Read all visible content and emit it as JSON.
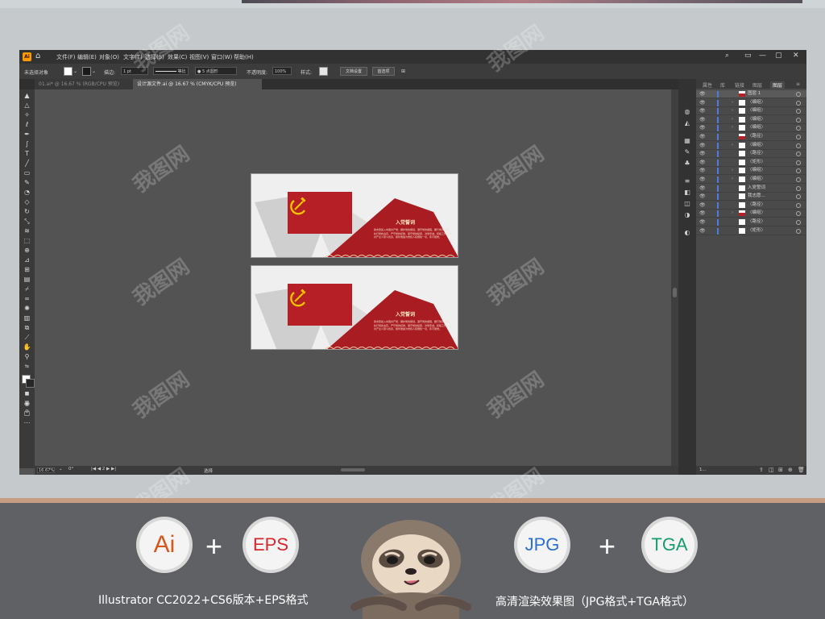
{
  "app": {
    "logo_text": "Ai",
    "menu": [
      "文件(F)",
      "编辑(E)",
      "对象(O)",
      "文字(T)",
      "选择(S)",
      "效果(C)",
      "视图(V)",
      "窗口(W)",
      "帮助(H)"
    ],
    "window_controls": [
      "—",
      "▢",
      "✕"
    ]
  },
  "controlbar": {
    "selection_label": "未选择对象",
    "stroke_label": "描边:",
    "stroke_value": "1 pt",
    "stroke_style": "等比",
    "brush": "5 点圆形",
    "opacity_label": "不透明度:",
    "opacity_value": "100%",
    "style_label": "样式:",
    "doc_setup_button": "文档设置",
    "preferences_button": "首选项"
  },
  "tabs": [
    {
      "label": "01.ai* @ 16.67 % (RGB/CPU 预览)",
      "active": false
    },
    {
      "label": "设计源文件.ai @ 16.67 % (CMYK/CPU 预览)",
      "active": true
    }
  ],
  "artboard": {
    "title": "入党誓词",
    "body": "我志愿加入中国共产党，拥护党的纲领，遵守党的章程，履行党员义务，执行党的决定，严守党的纪律，保守党的秘密，对党忠诚，积极工作，为共产主义奋斗终身，随时准备为党和人民牺牲一切，永不叛党。",
    "colors": {
      "red": "#b61f25",
      "dark_red": "#a91d22",
      "gold": "#f5c400",
      "grey_shape": "#cfcfcf"
    }
  },
  "status": {
    "zoom": "16.67%",
    "label": "选择"
  },
  "panel": {
    "tabs": [
      "属性",
      "库",
      "链接",
      "图层",
      "图层"
    ],
    "layers": [
      {
        "name": "图层 1",
        "top": true,
        "arrow": "",
        "red": true
      },
      {
        "name": "〈编组〉",
        "top": false,
        "arrow": "›",
        "red": false
      },
      {
        "name": "〈编组〉",
        "top": false,
        "arrow": "›",
        "red": false
      },
      {
        "name": "〈编组〉",
        "top": false,
        "arrow": "›",
        "red": false
      },
      {
        "name": "〈编组〉",
        "top": false,
        "arrow": "›",
        "red": false
      },
      {
        "name": "〈路径〉",
        "top": false,
        "arrow": "",
        "red": true
      },
      {
        "name": "〈编组〉",
        "top": false,
        "arrow": "›",
        "red": false
      },
      {
        "name": "〈路径〉",
        "top": false,
        "arrow": "",
        "red": false
      },
      {
        "name": "〈矩形〉",
        "top": false,
        "arrow": "",
        "red": false
      },
      {
        "name": "〈编组〉",
        "top": false,
        "arrow": "›",
        "red": false
      },
      {
        "name": "〈编组〉",
        "top": false,
        "arrow": "›",
        "red": false
      },
      {
        "name": "入党誓词",
        "top": false,
        "arrow": "",
        "red": false
      },
      {
        "name": "我志愿...",
        "top": false,
        "arrow": "",
        "red": false
      },
      {
        "name": "〈路径〉",
        "top": false,
        "arrow": "",
        "red": false
      },
      {
        "name": "〈编组〉",
        "top": false,
        "arrow": "›",
        "red": true
      },
      {
        "name": "〈路径〉",
        "top": false,
        "arrow": "",
        "red": false
      },
      {
        "name": "〈矩形〉",
        "top": false,
        "arrow": "",
        "red": false
      }
    ],
    "layer_count": "1..."
  },
  "watermark": "我图网",
  "promo": {
    "badges": [
      {
        "label": "Ai",
        "color": "#d4581c"
      },
      {
        "label": "EPS",
        "color": "#d8262b"
      },
      {
        "label": "JPG",
        "color": "#2a6fd1"
      },
      {
        "label": "TGA",
        "color": "#199b72"
      }
    ],
    "plus": "+",
    "caption_left": "Illustrator CC2022+CS6版本+EPS格式",
    "caption_right": "高清渲染效果图（JPG格式+TGA格式）"
  }
}
